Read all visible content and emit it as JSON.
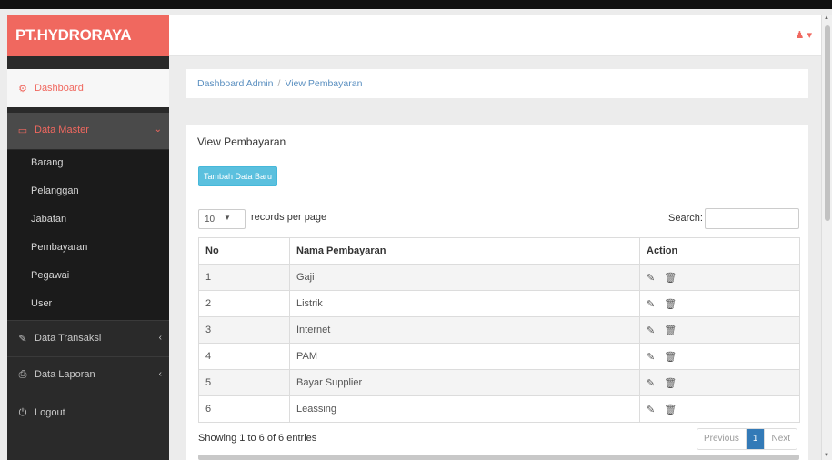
{
  "brand": {
    "name": "PT.HYDRORAYA",
    "color": "#f0685f"
  },
  "topbar": {
    "user_icon": "user-icon",
    "user_caret": "▾"
  },
  "sidebar": {
    "dashboard": {
      "label": "Dashboard",
      "icon": "dashboard-icon"
    },
    "data_master": {
      "label": "Data Master",
      "icon": "monitor-icon",
      "arrow": "⌄"
    },
    "submenu": [
      "Barang",
      "Pelanggan",
      "Jabatan",
      "Pembayaran",
      "Pegawai",
      "User"
    ],
    "data_transaksi": {
      "label": "Data Transaksi",
      "icon": "edit-icon",
      "arrow": "‹"
    },
    "data_laporan": {
      "label": "Data Laporan",
      "icon": "print-icon",
      "arrow": "‹"
    },
    "logout": {
      "label": "Logout",
      "icon": "power-icon"
    }
  },
  "breadcrumb": {
    "home": "Dashboard Admin",
    "separator": "/",
    "current": "View Pembayaran"
  },
  "panel": {
    "title": "View Pembayaran",
    "add_button": "Tambah Data Baru",
    "length_value": "10",
    "length_label": "records per page",
    "search_label": "Search:",
    "search_value": ""
  },
  "table": {
    "headers": [
      "No",
      "Nama Pembayaran",
      "Action"
    ],
    "rows": [
      {
        "no": "1",
        "nama": "Gaji"
      },
      {
        "no": "2",
        "nama": "Listrik"
      },
      {
        "no": "3",
        "nama": "Internet"
      },
      {
        "no": "4",
        "nama": "PAM"
      },
      {
        "no": "5",
        "nama": "Bayar Supplier"
      },
      {
        "no": "6",
        "nama": "Leassing"
      }
    ],
    "action_icons": [
      "edit-pencil-icon",
      "delete-trash-icon"
    ]
  },
  "footer": {
    "info": "Showing 1 to 6 of 6 entries",
    "prev": "Previous",
    "page": "1",
    "next": "Next"
  },
  "colors": {
    "accent": "#f0685f",
    "sidebar": "#2a2a2a",
    "button": "#5bc0de",
    "pager_active": "#337ab7"
  }
}
